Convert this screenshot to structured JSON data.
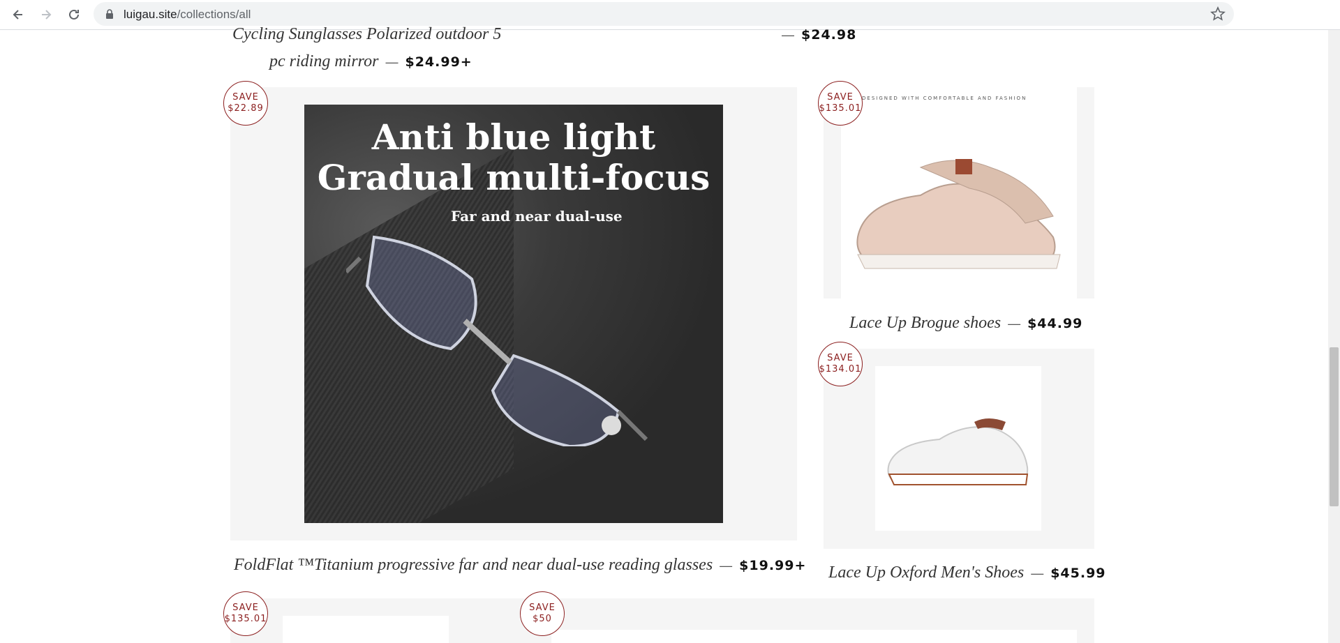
{
  "browser": {
    "url_host": "luigau.site",
    "url_path": "/collections/all",
    "back_icon": "back-arrow-icon",
    "forward_icon": "forward-arrow-icon",
    "reload_icon": "reload-icon",
    "lock_icon": "lock-icon",
    "bookmark_icon": "star-icon"
  },
  "products": {
    "top_left": {
      "title_line1": "Cycling Sunglasses Polarized outdoor 5",
      "title_line2": "pc riding mirror",
      "price": "$24.99+"
    },
    "top_right": {
      "price": "$24.98"
    },
    "glasses": {
      "badge_label": "SAVE",
      "badge_amount": "$22.89",
      "image_line1": "Anti blue light",
      "image_line2": "Gradual multi-focus",
      "image_line3": "Far and near dual-use",
      "title": "FoldFlat ™Titanium progressive far and near dual-use reading glasses",
      "price": "$19.99+"
    },
    "brogue": {
      "badge_label": "SAVE",
      "badge_amount": "$135.01",
      "image_caption": "DESIGNED WITH COMFORTABLE AND FASHION",
      "title": "Lace Up Brogue shoes",
      "price": "$44.99"
    },
    "oxford": {
      "badge_label": "SAVE",
      "badge_amount": "$134.01",
      "title": "Lace Up Oxford Men's Shoes",
      "price": "$45.99"
    },
    "bottom_left": {
      "badge_label": "SAVE",
      "badge_amount": "$135.01"
    },
    "bottom_right": {
      "badge_label": "SAVE",
      "badge_amount": "$50"
    }
  },
  "dash": "—",
  "colors": {
    "badge": "#8b1e1e",
    "card_bg": "#f5f5f5"
  }
}
